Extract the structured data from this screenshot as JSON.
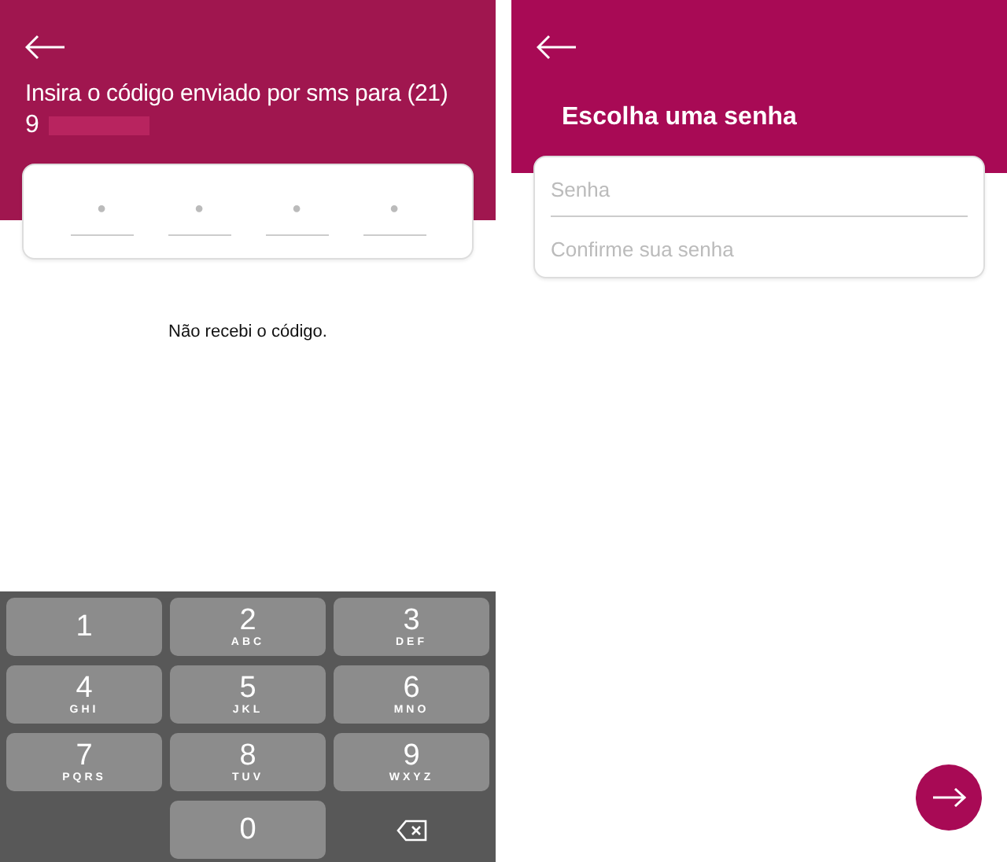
{
  "code_screen": {
    "title": "Insira o código enviado por sms para (21)",
    "phone_start": "9",
    "phone_hidden": true,
    "code_slots": [
      {
        "placeholder": "•"
      },
      {
        "placeholder": "•"
      },
      {
        "placeholder": "•"
      },
      {
        "placeholder": "•"
      }
    ],
    "resend_link": "Não recebi o código.",
    "keypad": [
      {
        "kind": "digit",
        "digit": "1"
      },
      {
        "kind": "digit",
        "digit": "2",
        "letters": "ABC"
      },
      {
        "kind": "digit",
        "digit": "3",
        "letters": "DEF"
      },
      {
        "kind": "digit",
        "digit": "4",
        "letters": "GHI"
      },
      {
        "kind": "digit",
        "digit": "5",
        "letters": "JKL"
      },
      {
        "kind": "digit",
        "digit": "6",
        "letters": "MNO"
      },
      {
        "kind": "digit",
        "digit": "7",
        "letters": "PQRS"
      },
      {
        "kind": "digit",
        "digit": "8",
        "letters": "TUV"
      },
      {
        "kind": "digit",
        "digit": "9",
        "letters": "WXYZ"
      },
      {
        "kind": "blank"
      },
      {
        "kind": "digit",
        "digit": "0"
      },
      {
        "kind": "delete"
      }
    ]
  },
  "password_screen": {
    "title": "Escolha uma senha",
    "fields": [
      {
        "placeholder": "Senha"
      },
      {
        "placeholder": "Confirme sua senha"
      }
    ]
  }
}
